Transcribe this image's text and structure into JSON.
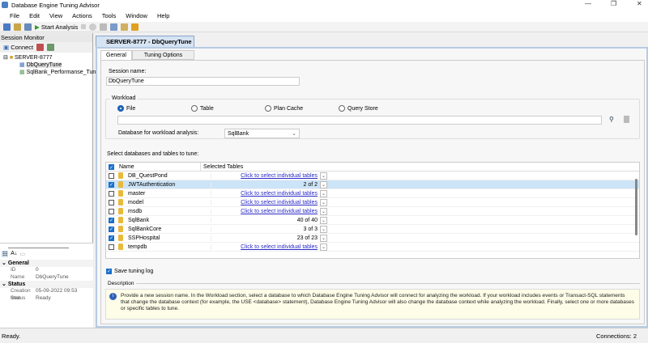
{
  "window": {
    "title": "Database Engine Tuning Advisor"
  },
  "menu": [
    "File",
    "Edit",
    "View",
    "Actions",
    "Tools",
    "Window",
    "Help"
  ],
  "toolbar": {
    "start_analysis": "Start Analysis"
  },
  "session_monitor": {
    "title": "Session Monitor",
    "connect": "Connect",
    "server": "SERVER-8777",
    "sessions": [
      "DbQueryTune",
      "SqlBank_Performanse_Tuni"
    ]
  },
  "properties": {
    "general": "General",
    "id_label": "ID",
    "id": "0",
    "name_label": "Name",
    "name": "DbQueryTune",
    "status_cat": "Status",
    "creation_label": "Creation time",
    "creation": "05-09-2022 09:53",
    "status_label": "Status",
    "status": "Ready"
  },
  "doc_tab": "SERVER-8777 - DbQueryTune",
  "tabs": [
    "General",
    "Tuning Options"
  ],
  "form": {
    "session_name_label": "Session name:",
    "session_name": "DbQueryTune",
    "workload": "Workload",
    "radios": [
      "File",
      "Table",
      "Plan Cache",
      "Query Store"
    ],
    "db_label": "Database for workload analysis:",
    "db_value": "SqlBank",
    "select_label": "Select databases and tables to tune:",
    "save_log": "Save tuning log",
    "description_label": "Description"
  },
  "grid": {
    "headers": [
      "Name",
      "Selected Tables"
    ],
    "rows": [
      {
        "name": "DB_QuestPond",
        "sel": "Click to select individual tables",
        "checked": false,
        "link": true
      },
      {
        "name": "JWTAuthentication",
        "sel": "2 of 2",
        "checked": true,
        "link": false
      },
      {
        "name": "master",
        "sel": "Click to select individual tables",
        "checked": false,
        "link": true
      },
      {
        "name": "model",
        "sel": "Click to select individual tables",
        "checked": false,
        "link": true
      },
      {
        "name": "msdb",
        "sel": "Click to select individual tables",
        "checked": false,
        "link": true
      },
      {
        "name": "SqlBank",
        "sel": "40 of 40",
        "checked": true,
        "link": false
      },
      {
        "name": "SqlBankCore",
        "sel": "3 of 3",
        "checked": true,
        "link": false
      },
      {
        "name": "SSPHospital",
        "sel": "23 of 23",
        "checked": true,
        "link": false
      },
      {
        "name": "tempdb",
        "sel": "Click to select individual tables",
        "checked": false,
        "link": true
      }
    ]
  },
  "description": "Provide a new session name. In the Workload section, select a database to which Database Engine Tuning Advisor will connect for analyzing the workload. If your workload includes events or Transact-SQL statements that change the database context (for example, the USE <database> statement), Database Engine Tuning Advisor will also change the database context while analyzing the workload. Finally, select one or more databases or specific tables to tune.",
  "statusbar": {
    "left": "Ready.",
    "right": "Connections: 2"
  }
}
